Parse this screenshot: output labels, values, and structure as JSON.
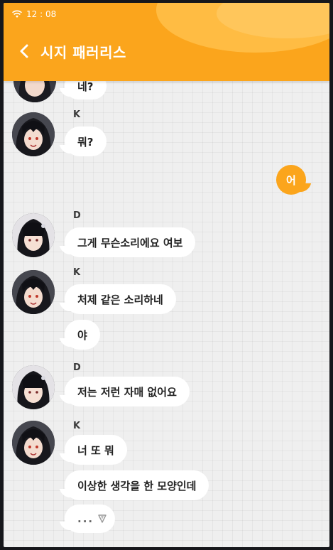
{
  "status_bar": {
    "time": "12 : 08"
  },
  "header": {
    "title": "시지 패러리스"
  },
  "colors": {
    "accent": "#fba51c",
    "background": "#efefef",
    "bubble": "#ffffff"
  },
  "messages": {
    "m0": {
      "text": "네?"
    },
    "g1": {
      "sender": "K",
      "lines": [
        "뭐?"
      ]
    },
    "me1": {
      "text": "어"
    },
    "g2": {
      "sender": "D",
      "lines": [
        "그게 무슨소리에요 여보"
      ]
    },
    "g3": {
      "sender": "K",
      "lines": [
        "처제 같은 소리하네",
        "야"
      ]
    },
    "g4": {
      "sender": "D",
      "lines": [
        "저는 저런 자매 없어요"
      ]
    },
    "g5": {
      "sender": "K",
      "lines": [
        "너 또 뭐",
        "이상한 생각을 한 모양인데",
        "..."
      ]
    }
  }
}
